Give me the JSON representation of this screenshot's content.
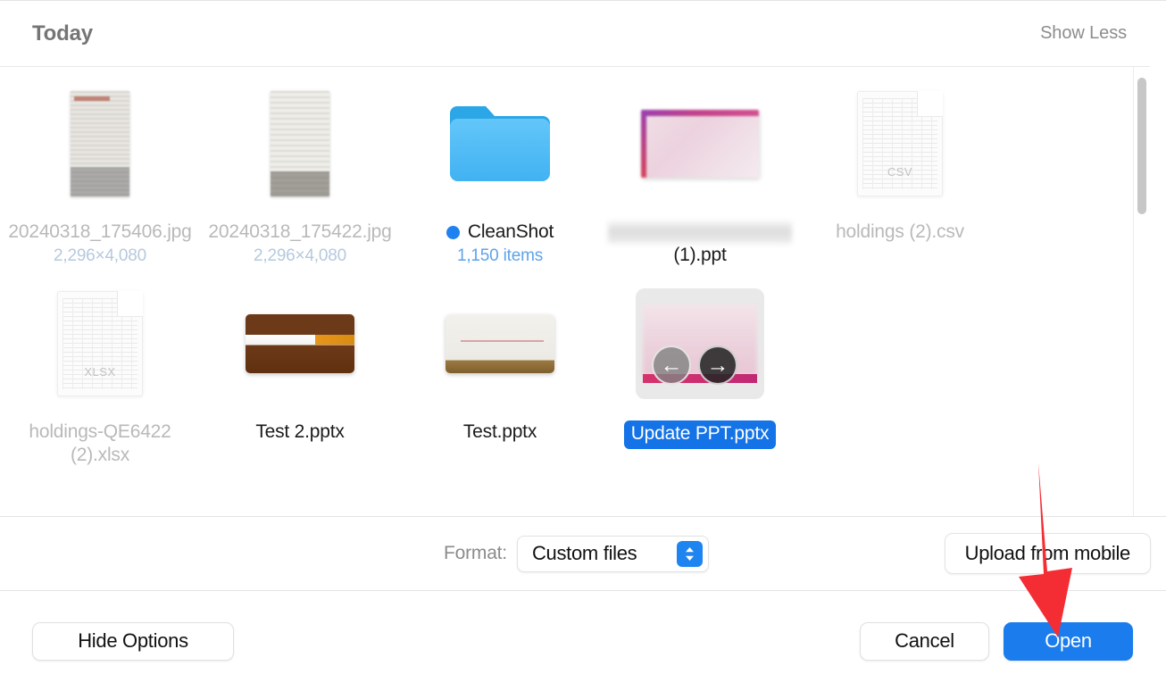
{
  "dialog": {
    "group_header": {
      "title": "Today",
      "toggle_label": "Show Less"
    },
    "files": [
      {
        "name": "20240318_175406.jpg",
        "subtitle": "2,296×4,080",
        "kind": "photo",
        "variant": "photo-a",
        "dimmed": true,
        "selected": false,
        "tag_color": ""
      },
      {
        "name": "20240318_175422.jpg",
        "subtitle": "2,296×4,080",
        "kind": "photo",
        "variant": "photo-b",
        "dimmed": true,
        "selected": false,
        "tag_color": ""
      },
      {
        "name": "CleanShot",
        "subtitle": "1,150 items",
        "kind": "folder",
        "variant": "folder-blue",
        "dimmed": false,
        "selected": false,
        "tag_color": "#1f82f0"
      },
      {
        "name": "(1).ppt",
        "subtitle": "",
        "kind": "presentation",
        "variant": "ppt-pink",
        "dimmed": false,
        "selected": false,
        "redacted_prefix": true,
        "tag_color": ""
      },
      {
        "name": "holdings (2).csv",
        "subtitle": "",
        "kind": "document",
        "variant": "csv",
        "file_type_label": "CSV",
        "dimmed": true,
        "selected": false,
        "tag_color": ""
      },
      {
        "name": "holdings-QE6422 (2).xlsx",
        "subtitle": "",
        "kind": "document",
        "variant": "xlsx",
        "file_type_label": "XLSX",
        "dimmed": true,
        "selected": false,
        "tag_color": ""
      },
      {
        "name": "Test 2.pptx",
        "subtitle": "",
        "kind": "presentation",
        "variant": "slide-brown",
        "dimmed": false,
        "selected": false,
        "tag_color": ""
      },
      {
        "name": "Test.pptx",
        "subtitle": "",
        "kind": "presentation",
        "variant": "slide-cream",
        "dimmed": false,
        "selected": false,
        "tag_color": ""
      },
      {
        "name": "Update PPT.pptx",
        "subtitle": "",
        "kind": "presentation",
        "variant": "quicklook",
        "dimmed": false,
        "selected": true,
        "tag_color": ""
      }
    ],
    "quicklook": {
      "back_arrow": "←",
      "forward_arrow": "→"
    },
    "format_bar": {
      "label": "Format:",
      "selected_option": "Custom files",
      "upload_button": "Upload from mobile"
    },
    "actions": {
      "hide_options": "Hide Options",
      "cancel": "Cancel",
      "open": "Open"
    },
    "colors": {
      "accent": "#1a7ced",
      "selection": "#1473e6",
      "folder": "#55bdf5",
      "annotation": "#f42d34",
      "dim_text": "#b9b9b9",
      "subtitle_blue": "#b6c9de"
    }
  }
}
